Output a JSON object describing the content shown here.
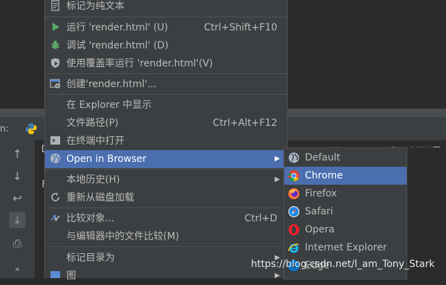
{
  "run_panel": {
    "label": "n:",
    "console_line1": "D",
    "console_line2": "F",
    "console_path_fragment": "U         Py/CSDN用/Py"
  },
  "menu": {
    "items": [
      {
        "label": "标记为纯文本",
        "shortcut": "",
        "icon": "text-file-icon"
      },
      {
        "label": "运行 'render.html' (U)",
        "shortcut": "Ctrl+Shift+F10",
        "icon": "run-triangle-icon"
      },
      {
        "label": "调试 'render.html' (D)",
        "shortcut": "",
        "icon": "bug-icon"
      },
      {
        "label": "使用覆盖率运行  'render.html'(V)",
        "shortcut": "",
        "icon": "coverage-shield-icon"
      },
      {
        "label": "创建'render.html'...",
        "shortcut": "",
        "icon": "create-config-icon"
      },
      {
        "label": "在 Explorer 中显示",
        "shortcut": "",
        "icon": ""
      },
      {
        "label": "文件路径(P)",
        "shortcut": "Ctrl+Alt+F12",
        "icon": ""
      },
      {
        "label": "在终端中打开",
        "shortcut": "",
        "icon": "terminal-icon"
      },
      {
        "label": "Open in Browser",
        "shortcut": "",
        "icon": "globe-icon"
      },
      {
        "label": "本地历史(H)",
        "shortcut": "",
        "icon": ""
      },
      {
        "label": "重新从磁盘加载",
        "shortcut": "",
        "icon": "reload-icon"
      },
      {
        "label": "比较对象...",
        "shortcut": "Ctrl+D",
        "icon": "compare-arrows-icon"
      },
      {
        "label": "与编辑器中的文件比较(M)",
        "shortcut": "",
        "icon": ""
      },
      {
        "label": "标记目录为",
        "shortcut": "",
        "icon": ""
      },
      {
        "label": "图",
        "shortcut": "",
        "icon": "diagram-icon"
      }
    ]
  },
  "browser_submenu": {
    "items": [
      {
        "label": "Default",
        "icon": "globe-icon"
      },
      {
        "label": "Chrome",
        "icon": "chrome-icon"
      },
      {
        "label": "Firefox",
        "icon": "firefox-icon"
      },
      {
        "label": "Safari",
        "icon": "safari-icon"
      },
      {
        "label": "Opera",
        "icon": "opera-icon"
      },
      {
        "label": "Internet Explorer",
        "icon": "internet-explorer-icon"
      },
      {
        "label": "Edge",
        "icon": "edge-icon"
      }
    ]
  },
  "watermark": "https://blog.csdn.net/l_am_Tony_Stark",
  "colors": {
    "highlight": "#4b6eaf",
    "menu_bg": "#3c3f41",
    "run_green": "#59a869"
  }
}
